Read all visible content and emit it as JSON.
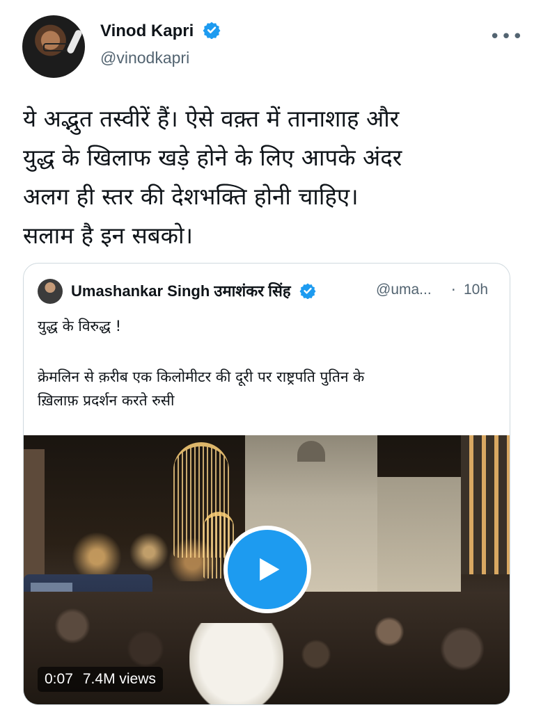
{
  "tweet": {
    "author": {
      "display_name": "Vinod Kapri",
      "handle": "@vinodkapri",
      "verified": true
    },
    "text": "ये अद्भुत तस्वीरें हैं। ऐसे वक़्त में तानाशाह और\nयुद्ध के खिलाफ खड़े होने के लिए आपके अंदर\nअलग ही स्तर की देशभक्ति होनी चाहिए।\nसलाम है इन सबको।",
    "more_icon": "more-horizontal-icon"
  },
  "quoted_tweet": {
    "author": {
      "display_name": "Umashankar Singh उमाशंकर सिंह",
      "handle": "@uma...",
      "verified": true
    },
    "separator": "·",
    "time": "10h",
    "line1": "युद्ध के विरुद्ध !",
    "line2": "क्रेमलिन से क़रीब एक किलोमीटर की दूरी पर राष्ट्रपति पुतिन के\nख़िलाफ़ प्रदर्शन करते रुसी",
    "video": {
      "duration": "0:07",
      "views": "7.4M views",
      "play_icon": "play-icon"
    }
  },
  "colors": {
    "verified_blue": "#1d9bf0",
    "text_primary": "#0f1419",
    "text_secondary": "#536471",
    "border": "#cfd9de"
  }
}
